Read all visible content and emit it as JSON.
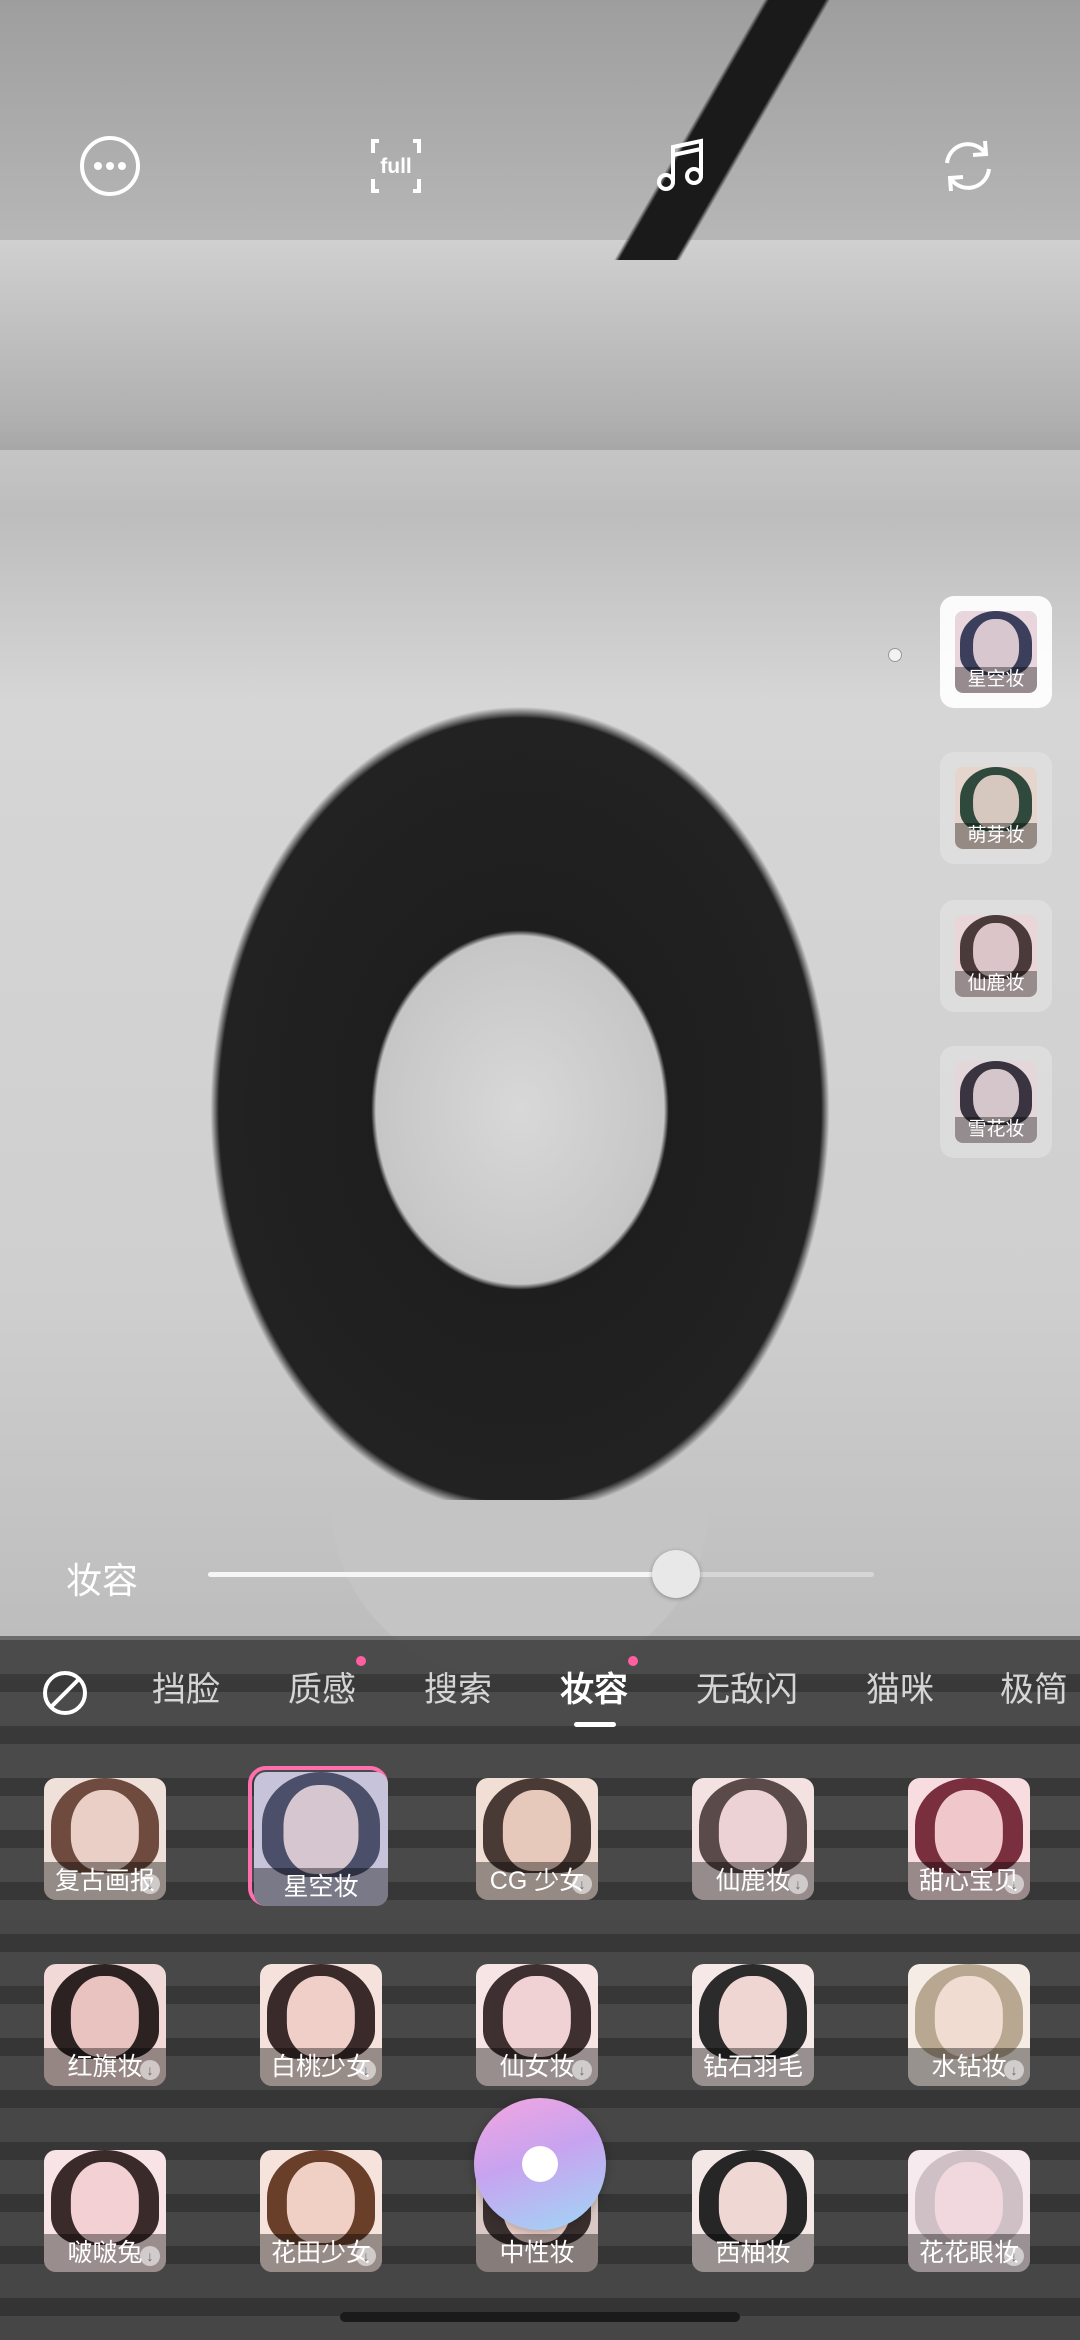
{
  "toolbar": {
    "more_icon": "more-horizontal-circle-icon",
    "aspect_label": "full",
    "music_icon": "music-note-icon",
    "flip_icon": "camera-flip-icon"
  },
  "quick_makeup": [
    {
      "label": "星空妆",
      "selected": true
    },
    {
      "label": "萌芽妆",
      "selected": false
    },
    {
      "label": "仙鹿妆",
      "selected": false
    },
    {
      "label": "雪花妆",
      "selected": false
    }
  ],
  "slider": {
    "label": "妆容",
    "value_fraction": 0.7
  },
  "tabs": [
    {
      "label": "挡脸",
      "active": false,
      "dot": false
    },
    {
      "label": "质感",
      "active": false,
      "dot": true
    },
    {
      "label": "搜索",
      "active": false,
      "dot": false
    },
    {
      "label": "妆容",
      "active": true,
      "dot": true
    },
    {
      "label": "无敌闪",
      "active": false,
      "dot": false
    },
    {
      "label": "猫咪",
      "active": false,
      "dot": false
    },
    {
      "label": "极简",
      "active": false,
      "dot": false
    }
  ],
  "grid": [
    {
      "label": "复古画报",
      "download": true
    },
    {
      "label": "星空妆",
      "download": false,
      "selected": true
    },
    {
      "label": "CG 少女",
      "download": true
    },
    {
      "label": "仙鹿妆",
      "download": true
    },
    {
      "label": "甜心宝贝",
      "download": true
    },
    {
      "label": "红旗妆",
      "download": true
    },
    {
      "label": "白桃少女",
      "download": true
    },
    {
      "label": "仙女妆",
      "download": true
    },
    {
      "label": "钻石羽毛",
      "download": false
    },
    {
      "label": "水钻妆",
      "download": true
    },
    {
      "label": "啵啵兔",
      "download": true
    },
    {
      "label": "花田少女",
      "download": true
    },
    {
      "label": "中性妆",
      "download": false
    },
    {
      "label": "西柚妆",
      "download": false
    },
    {
      "label": "花花眼妆",
      "download": true
    }
  ],
  "colors": {
    "accent_pink": "#ff6fae",
    "tab_dot": "#ff5fa2"
  }
}
